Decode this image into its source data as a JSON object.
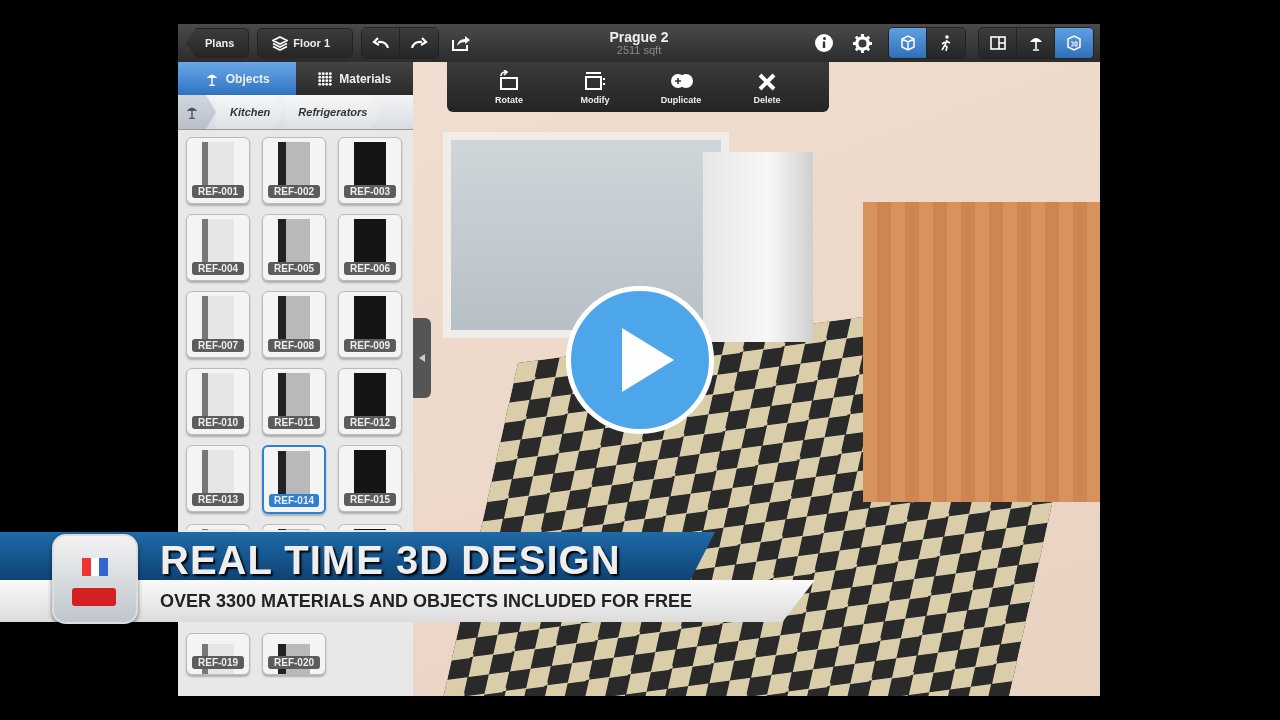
{
  "toolbar": {
    "nav_buttons": [
      {
        "kind": "back",
        "label": "Plans"
      },
      {
        "kind": "layers",
        "label": "Floor 1"
      }
    ],
    "title": "Prague 2",
    "subtitle": "2511 sqft",
    "camera_modes": [
      {
        "kind": "cube",
        "selected": true
      },
      {
        "kind": "walk",
        "selected": false
      }
    ],
    "view_modes": [
      {
        "kind": "split",
        "selected": false
      },
      {
        "kind": "lamp",
        "selected": false
      },
      {
        "kind": "threed",
        "selected": true
      }
    ]
  },
  "panel": {
    "tabs": [
      {
        "kind": "lamp",
        "label": "Objects",
        "selected": true
      },
      {
        "kind": "grid",
        "label": "Materials",
        "selected": false
      }
    ],
    "breadcrumb": [
      "Kitchen",
      "Refrigerators"
    ],
    "items": [
      {
        "label": "REF-001",
        "selected": false
      },
      {
        "label": "REF-002",
        "selected": false
      },
      {
        "label": "REF-003",
        "selected": false
      },
      {
        "label": "REF-004",
        "selected": false
      },
      {
        "label": "REF-005",
        "selected": false
      },
      {
        "label": "REF-006",
        "selected": false
      },
      {
        "label": "REF-007",
        "selected": false
      },
      {
        "label": "REF-008",
        "selected": false
      },
      {
        "label": "REF-009",
        "selected": false
      },
      {
        "label": "REF-010",
        "selected": false
      },
      {
        "label": "REF-011",
        "selected": false
      },
      {
        "label": "REF-012",
        "selected": false
      },
      {
        "label": "REF-013",
        "selected": false
      },
      {
        "label": "REF-014",
        "selected": true
      },
      {
        "label": "REF-015",
        "selected": false
      },
      {
        "selected": false
      },
      {
        "selected": false
      },
      {
        "selected": false
      },
      {
        "label": "REF-019",
        "selected": false
      },
      {
        "label": "REF-020",
        "selected": false
      }
    ]
  },
  "actions": [
    {
      "kind": "rotate",
      "label": "Rotate"
    },
    {
      "kind": "modify",
      "label": "Modify"
    },
    {
      "kind": "duplicate",
      "label": "Duplicate"
    },
    {
      "kind": "delete",
      "label": "Delete"
    }
  ],
  "banner": {
    "headline": "REAL TIME 3D DESIGN",
    "tagline": "OVER 3300 MATERIALS AND OBJECTS INCLUDED FOR FREE"
  }
}
